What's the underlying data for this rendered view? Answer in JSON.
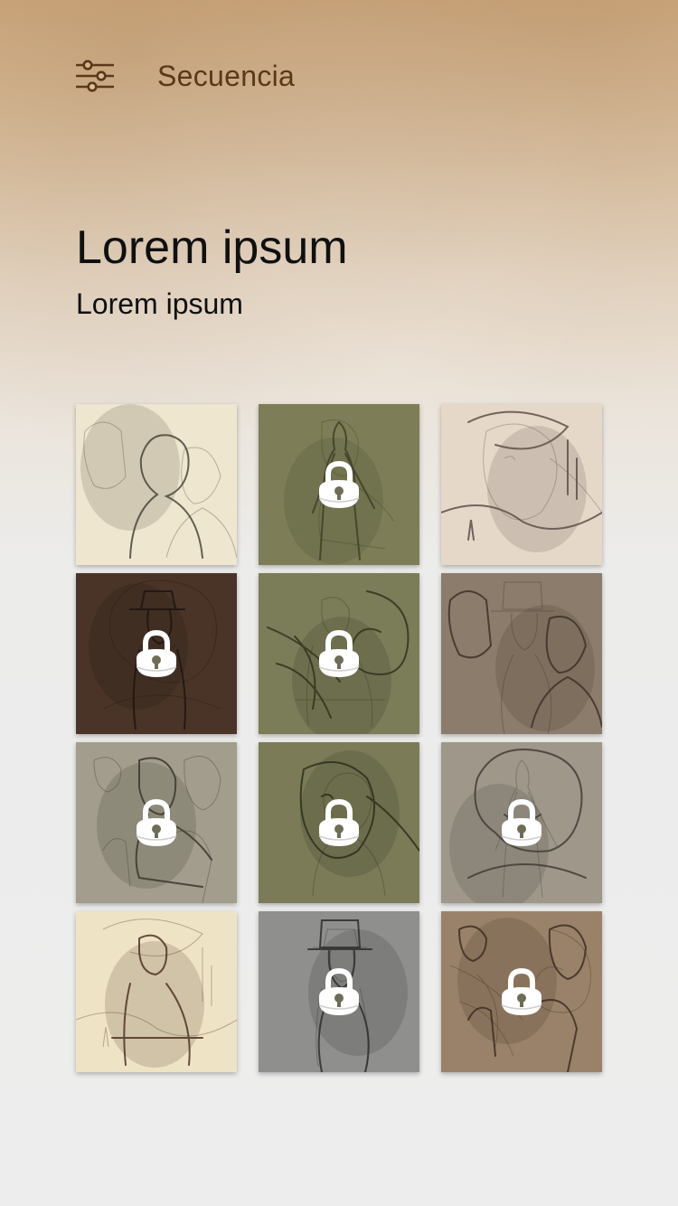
{
  "header": {
    "title": "Secuencia",
    "menu_icon": "sliders-icon"
  },
  "main": {
    "title": "Lorem ipsum",
    "subtitle": "Lorem ipsum"
  },
  "gallery": {
    "lock_icon": "padlock-icon",
    "items": [
      {
        "scene": "old-man-sketch",
        "locked": false,
        "bg": "#efe6d0",
        "ink": "#4a4638"
      },
      {
        "scene": "figure-sketch-green",
        "locked": true,
        "bg": "#7d7d57",
        "ink": "#3f4028"
      },
      {
        "scene": "desert-giant-landscape",
        "locked": false,
        "bg": "#e6d8c8",
        "ink": "#5a5048"
      },
      {
        "scene": "man-in-hat-interior",
        "locked": true,
        "bg": "#4a3428",
        "ink": "#1e1410"
      },
      {
        "scene": "nautilus-creature-sketch",
        "locked": true,
        "bg": "#7b7c58",
        "ink": "#34341f"
      },
      {
        "scene": "masked-figure-and-woman",
        "locked": false,
        "bg": "#8c7c6b",
        "ink": "#3d3228"
      },
      {
        "scene": "hooded-woman-sitting",
        "locked": true,
        "bg": "#a29d8c",
        "ink": "#3a362e"
      },
      {
        "scene": "creature-head-sketch",
        "locked": true,
        "bg": "#7b7c57",
        "ink": "#2e2f1c"
      },
      {
        "scene": "curly-haired-woman",
        "locked": true,
        "bg": "#9e978a",
        "ink": "#433c35"
      },
      {
        "scene": "bearded-man-seated",
        "locked": false,
        "bg": "#efe3c6",
        "ink": "#4a3424"
      },
      {
        "scene": "man-top-hat-grey",
        "locked": true,
        "bg": "#8f8f8d",
        "ink": "#2e2e2e"
      },
      {
        "scene": "women-sketch-study",
        "locked": true,
        "bg": "#9a826a",
        "ink": "#3e2e22"
      }
    ]
  }
}
